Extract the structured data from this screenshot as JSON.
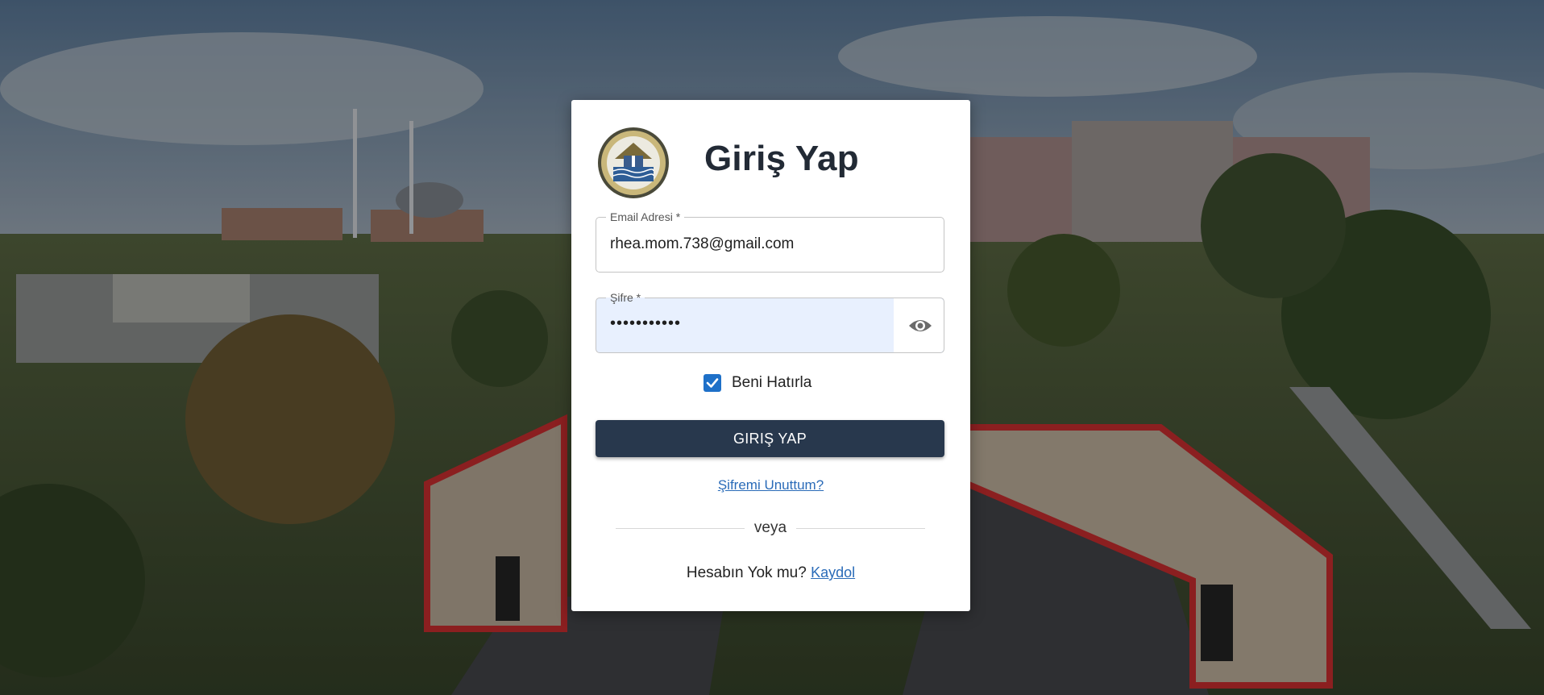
{
  "login": {
    "title": "Giriş Yap",
    "email_label": "Email Adresi *",
    "email_value": "rhea.mom.738@gmail.com",
    "password_label": "Şifre *",
    "password_value": "•••••••••••",
    "remember_label": "Beni Hatırla",
    "remember_checked": true,
    "submit_label": "GIRIŞ YAP",
    "forgot_label": "Şifremi Unuttum?",
    "divider_label": "veya",
    "no_account_label": "Hesabın Yok mu?",
    "signup_label": "Kaydol"
  },
  "icons": {
    "logo": "university-seal-logo",
    "show_password": "eye-icon",
    "checkbox": "checkmark-icon"
  },
  "colors": {
    "button": "#28384d",
    "link": "#2a6bb8",
    "checkbox": "#1e70c8",
    "autofill": "#e8f0fe"
  }
}
